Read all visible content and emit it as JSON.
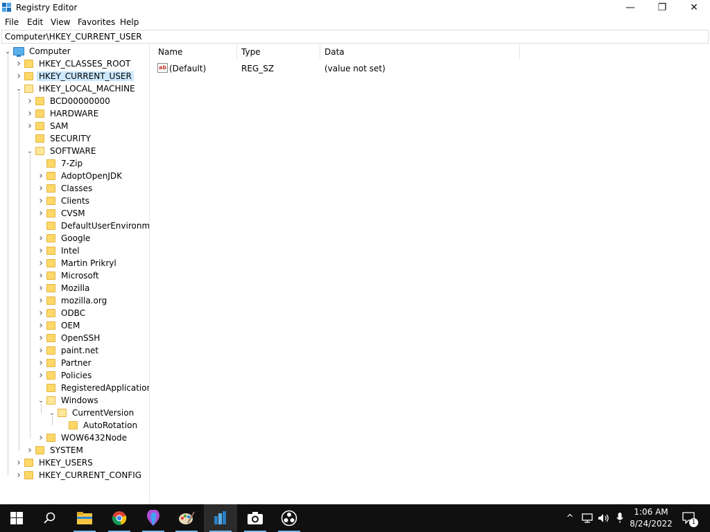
{
  "window": {
    "title": "Registry Editor",
    "minimize_glyph": "—",
    "maximize_glyph": "❐",
    "close_glyph": "✕"
  },
  "menu": [
    "File",
    "Edit",
    "View",
    "Favorites",
    "Help"
  ],
  "address": "Computer\\HKEY_CURRENT_USER",
  "tree": {
    "root": "Computer",
    "nodes": [
      {
        "label": "HKEY_CLASSES_ROOT",
        "level": 1,
        "chevron": "closed"
      },
      {
        "label": "HKEY_CURRENT_USER",
        "level": 1,
        "chevron": "closed",
        "selected": true
      },
      {
        "label": "HKEY_LOCAL_MACHINE",
        "level": 1,
        "chevron": "open"
      },
      {
        "label": "BCD00000000",
        "level": 2,
        "chevron": "closed"
      },
      {
        "label": "HARDWARE",
        "level": 2,
        "chevron": "closed"
      },
      {
        "label": "SAM",
        "level": 2,
        "chevron": "closed"
      },
      {
        "label": "SECURITY",
        "level": 2,
        "chevron": "none"
      },
      {
        "label": "SOFTWARE",
        "level": 2,
        "chevron": "open"
      },
      {
        "label": "7-Zip",
        "level": 3,
        "chevron": "none"
      },
      {
        "label": "AdoptOpenJDK",
        "level": 3,
        "chevron": "closed"
      },
      {
        "label": "Classes",
        "level": 3,
        "chevron": "closed"
      },
      {
        "label": "Clients",
        "level": 3,
        "chevron": "closed"
      },
      {
        "label": "CVSM",
        "level": 3,
        "chevron": "closed"
      },
      {
        "label": "DefaultUserEnvironmen",
        "level": 3,
        "chevron": "none"
      },
      {
        "label": "Google",
        "level": 3,
        "chevron": "closed"
      },
      {
        "label": "Intel",
        "level": 3,
        "chevron": "closed"
      },
      {
        "label": "Martin Prikryl",
        "level": 3,
        "chevron": "closed"
      },
      {
        "label": "Microsoft",
        "level": 3,
        "chevron": "closed"
      },
      {
        "label": "Mozilla",
        "level": 3,
        "chevron": "closed"
      },
      {
        "label": "mozilla.org",
        "level": 3,
        "chevron": "closed"
      },
      {
        "label": "ODBC",
        "level": 3,
        "chevron": "closed"
      },
      {
        "label": "OEM",
        "level": 3,
        "chevron": "closed"
      },
      {
        "label": "OpenSSH",
        "level": 3,
        "chevron": "closed"
      },
      {
        "label": "paint.net",
        "level": 3,
        "chevron": "closed"
      },
      {
        "label": "Partner",
        "level": 3,
        "chevron": "closed"
      },
      {
        "label": "Policies",
        "level": 3,
        "chevron": "closed"
      },
      {
        "label": "RegisteredApplications",
        "level": 3,
        "chevron": "none"
      },
      {
        "label": "Windows",
        "level": 3,
        "chevron": "open"
      },
      {
        "label": "CurrentVersion",
        "level": 4,
        "chevron": "open"
      },
      {
        "label": "AutoRotation",
        "level": 5,
        "chevron": "none"
      },
      {
        "label": "WOW6432Node",
        "level": 3,
        "chevron": "closed"
      },
      {
        "label": "SYSTEM",
        "level": 2,
        "chevron": "closed"
      },
      {
        "label": "HKEY_USERS",
        "level": 1,
        "chevron": "closed"
      },
      {
        "label": "HKEY_CURRENT_CONFIG",
        "level": 1,
        "chevron": "closed"
      }
    ]
  },
  "list": {
    "columns": [
      "Name",
      "Type",
      "Data"
    ],
    "rows": [
      {
        "icon": "string-value-icon",
        "icon_text": "ab",
        "name": "(Default)",
        "type": "REG_SZ",
        "data": "(value not set)"
      }
    ]
  },
  "taskbar": {
    "apps": [
      "start-icon",
      "search-icon",
      "file-explorer-icon",
      "chrome-icon",
      "paint-3d-icon",
      "paint-icon",
      "registry-editor-icon",
      "camera-icon",
      "obs-icon"
    ],
    "active_app": "registry-editor-icon",
    "tray": {
      "chevron": "^",
      "time": "1:06 AM",
      "date": "8/24/2022",
      "notification_count": "1"
    }
  },
  "colors": {
    "selection": "#cce8ff",
    "folder": "#fdd868",
    "taskbar": "#101010",
    "taskbar_accent": "#76b9ed"
  }
}
